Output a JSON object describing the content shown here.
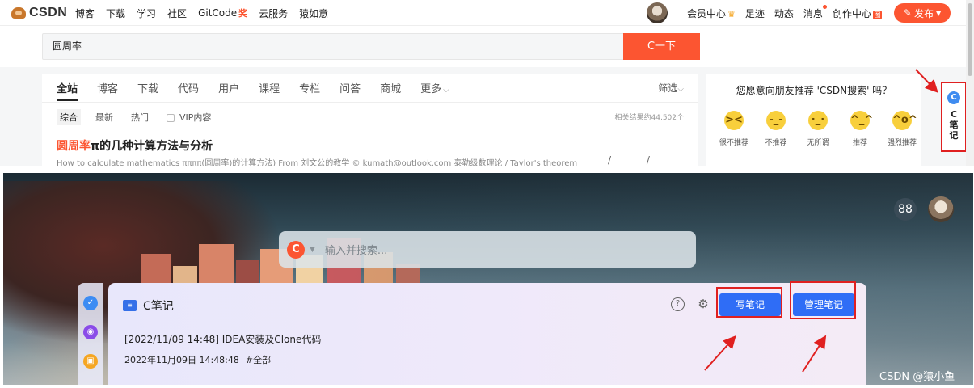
{
  "top": {
    "logo_text": "CSDN",
    "nav_links": [
      "博客",
      "下载",
      "学习",
      "社区",
      "GitCode",
      "云服务",
      "猿如意"
    ],
    "gitcode_badge": "奖",
    "nav_right": {
      "member": "会员中心",
      "footprint": "足迹",
      "dynamic": "动态",
      "messages": "消息",
      "creator": "创作中心",
      "creator_badge": "图",
      "publish": "发布"
    },
    "search": {
      "value": "圆周率",
      "button": "C一下"
    },
    "tabs": [
      "全站",
      "博客",
      "下载",
      "代码",
      "用户",
      "课程",
      "专栏",
      "问答",
      "商城",
      "更多"
    ],
    "filter": "筛选",
    "subtabs": [
      "综合",
      "最新",
      "热门"
    ],
    "vip_label": "VIP内容",
    "result_count": "相关结果约44,502个",
    "result": {
      "title_highlight": "圆周率",
      "title_rest": "π的几种计算方法与分析",
      "desc": "How to calculate mathematics ππππ(圆周率)的计算方法) From 刘文公的教学 © kumath@outlook.com 泰勒级数理论 / Taylor's theorem",
      "thumb": "/ / \\"
    },
    "survey": {
      "question": "您愿意向朋友推荐 'CSDN搜索' 吗？",
      "options": [
        {
          "label": "很不推荐",
          "face": "><"
        },
        {
          "label": "不推荐",
          "face": "-_-"
        },
        {
          "label": "无所谓",
          "face": "·_·"
        },
        {
          "label": "推荐",
          "face": "^_^"
        },
        {
          "label": "强烈推荐",
          "face": "^o^"
        }
      ]
    },
    "side_note": "C笔记"
  },
  "bottom": {
    "search_placeholder": "输入并搜索...",
    "apps_icon": "88",
    "note": {
      "title": "C笔记",
      "write_button": "写笔记",
      "manage_button": "管理笔记",
      "entry": "[2022/11/09 14:48] IDEA安装及Clone代码",
      "date": "2022年11月09日 14:48:48",
      "tag": "#全部"
    },
    "watermark": "CSDN @猿小鱼"
  },
  "colors": {
    "brand": "#fc5531",
    "primary_blue": "#2f6df6",
    "highlight_red": "#e02020"
  }
}
